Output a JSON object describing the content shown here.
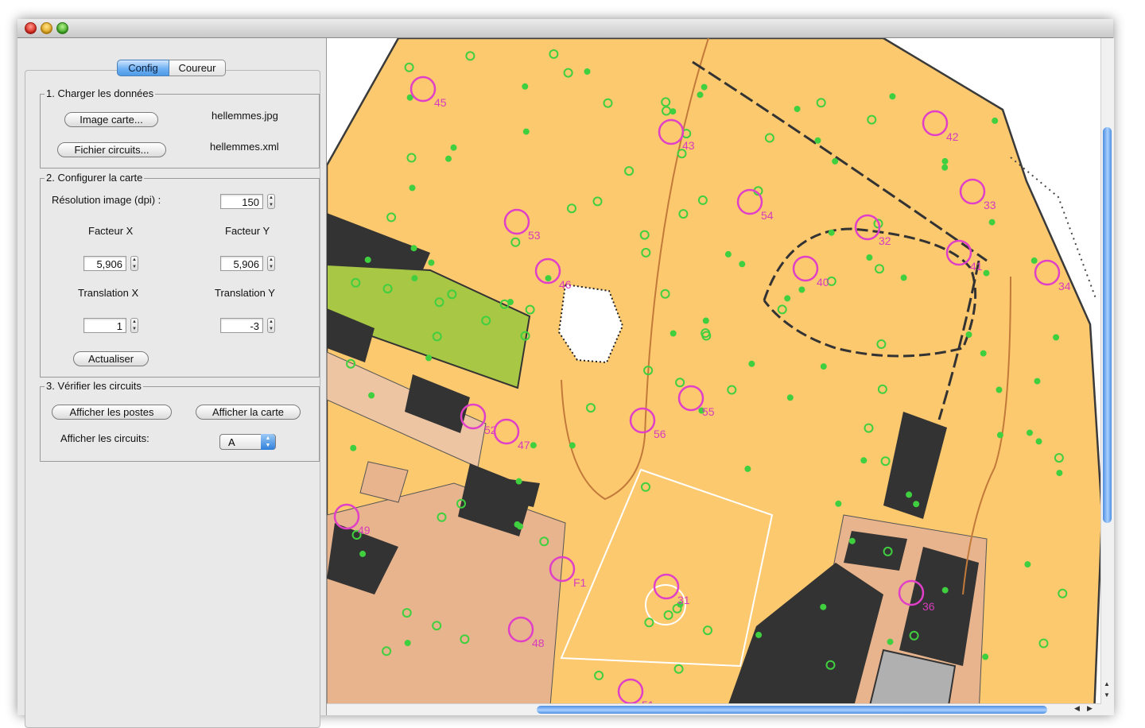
{
  "tabs": {
    "config": "Config",
    "coureur": "Coureur"
  },
  "group1": {
    "title": "1. Charger les données",
    "image_button": "Image carte...",
    "image_file": "hellemmes.jpg",
    "circuits_button": "Fichier circuits...",
    "circuits_file": "hellemmes.xml"
  },
  "group2": {
    "title": "2. Configurer la carte",
    "resolution_label": "Résolution image (dpi) :",
    "resolution_value": "150",
    "factor_x_label": "Facteur X",
    "factor_y_label": "Facteur Y",
    "factor_x_value": "5,906",
    "factor_y_value": "5,906",
    "translation_x_label": "Translation X",
    "translation_y_label": "Translation Y",
    "translation_x_value": "1",
    "translation_y_value": "-3",
    "update_button": "Actualiser"
  },
  "group3": {
    "title": "3. Vérifier les circuits",
    "show_controls_button": "Afficher les postes",
    "show_map_button": "Afficher la carte",
    "show_circuits_label": "Afficher les circuits:",
    "circuit_selected": "A"
  },
  "map": {
    "controls": [
      "45",
      "43",
      "42",
      "33",
      "54",
      "53",
      "46",
      "32",
      "41",
      "40",
      "34",
      "55",
      "56",
      "52",
      "47",
      "49",
      "F1",
      "31",
      "36",
      "48",
      "51"
    ]
  }
}
